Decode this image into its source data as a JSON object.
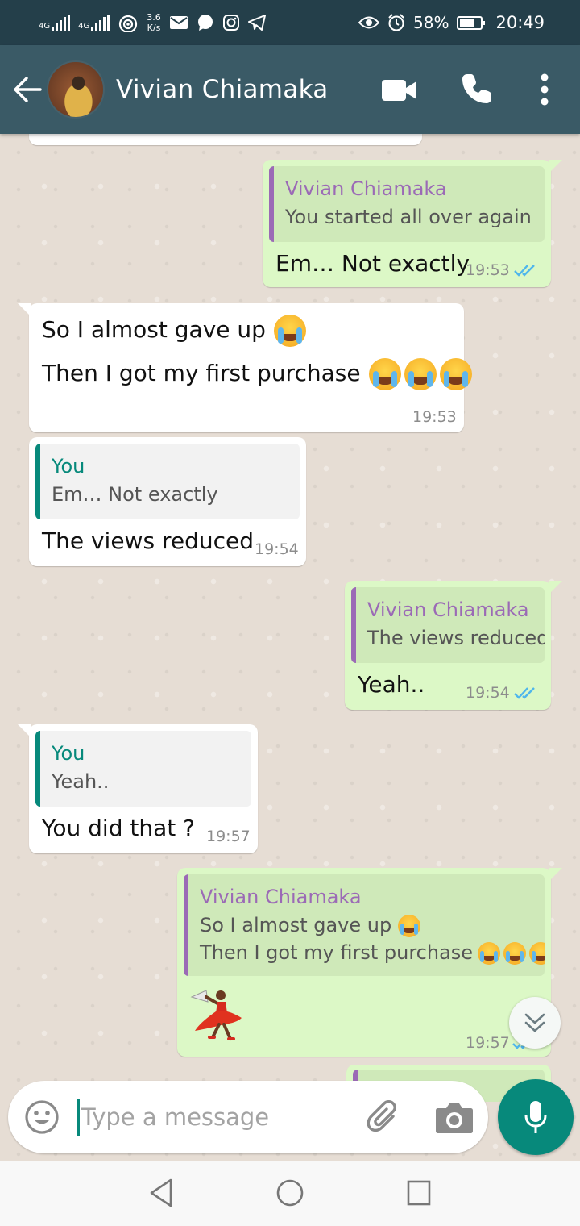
{
  "status_bar": {
    "network_1": "4G",
    "network_2": "4G",
    "speed_value": "3.6",
    "speed_unit": "K/s",
    "battery": "58%",
    "time": "20:49"
  },
  "header": {
    "contact_name": "Vivian Chiamaka",
    "icons": [
      "back-arrow-icon",
      "video-call-icon",
      "phone-icon",
      "more-vert-icon"
    ]
  },
  "messages": [
    {
      "direction": "outgoing",
      "quote_author": "Vivian Chiamaka",
      "quote_text": "You started all over again",
      "text": "Em… Not exactly",
      "time": "19:53",
      "status": "read"
    },
    {
      "direction": "incoming",
      "line1": "So I almost gave up",
      "line2": "Then I got my first purchase",
      "time": "19:53"
    },
    {
      "direction": "incoming",
      "quote_author": "You",
      "quote_text": "Em… Not exactly",
      "text": "The views reduced",
      "time": "19:54"
    },
    {
      "direction": "outgoing",
      "quote_author": "Vivian Chiamaka",
      "quote_text": "The views reduced",
      "text": "Yeah..",
      "time": "19:54",
      "status": "read"
    },
    {
      "direction": "incoming",
      "quote_author": "You",
      "quote_text": "Yeah..",
      "text": "You did that ?",
      "time": "19:57"
    },
    {
      "direction": "outgoing",
      "quote_author": "Vivian Chiamaka",
      "quote_line1": "So I almost gave up",
      "quote_line2": "Then I got my first purchase",
      "sticker": "dancer-emoji",
      "time": "19:57",
      "status": "read"
    }
  ],
  "composer": {
    "placeholder": "Type a message",
    "value": ""
  },
  "colors": {
    "header": "#3a5a66",
    "status_bar": "#243f4a",
    "outgoing_bubble": "#dcf8c6",
    "incoming_bubble": "#ffffff",
    "accent": "#07897b",
    "quote_author_outgoing": "#9b6ab6",
    "read_ticks": "#4fb6ec"
  }
}
